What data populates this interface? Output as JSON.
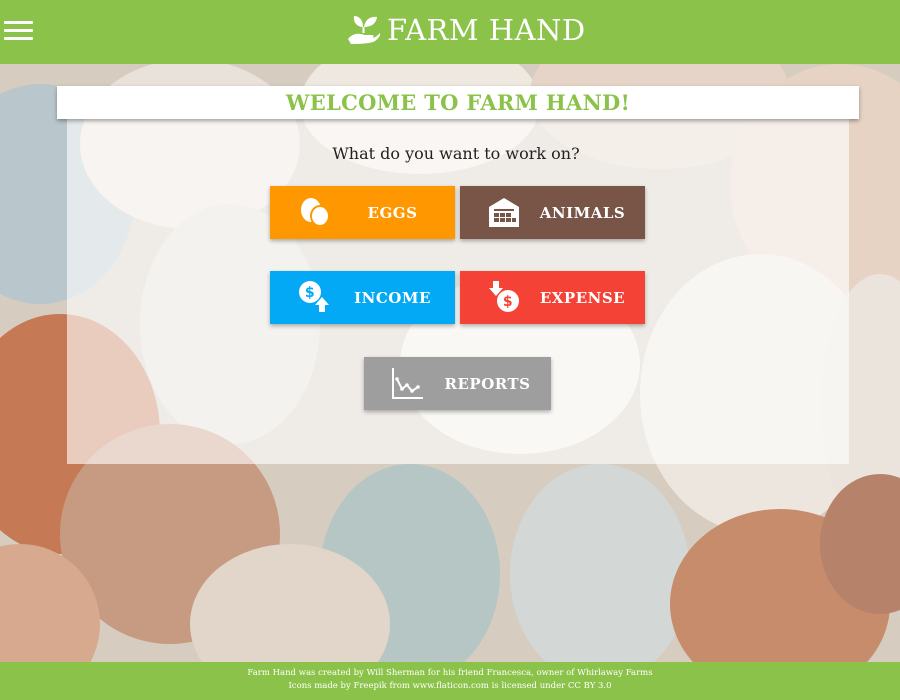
{
  "header": {
    "menu_icon": "hamburger-menu-icon",
    "logo_icon": "sprout-hand-icon",
    "title": "FARM HAND"
  },
  "welcome": {
    "title": "WELCOME TO FARM HAND!",
    "prompt": "What do you want to work on?"
  },
  "buttons": {
    "eggs": {
      "label": "EGGS",
      "icon": "eggs-icon",
      "color": "#ff9800"
    },
    "animals": {
      "label": "ANIMALS",
      "icon": "barn-icon",
      "color": "#795548"
    },
    "income": {
      "label": "INCOME",
      "icon": "money-bag-up-arrow-icon",
      "color": "#03a9f4"
    },
    "expense": {
      "label": "EXPENSE",
      "icon": "money-bag-down-arrow-icon",
      "color": "#f44336"
    },
    "reports": {
      "label": "REPORTS",
      "icon": "line-chart-icon",
      "color": "#9e9e9e"
    }
  },
  "footer": {
    "line1": "Farm Hand was created by Will Sherman for his friend Francesca, owner of Whirlaway Farms",
    "line2": "Icons made by Freepik from www.flaticon.com is licensed under CC BY 3.0"
  },
  "theme": {
    "brand_green": "#8bc34a"
  }
}
